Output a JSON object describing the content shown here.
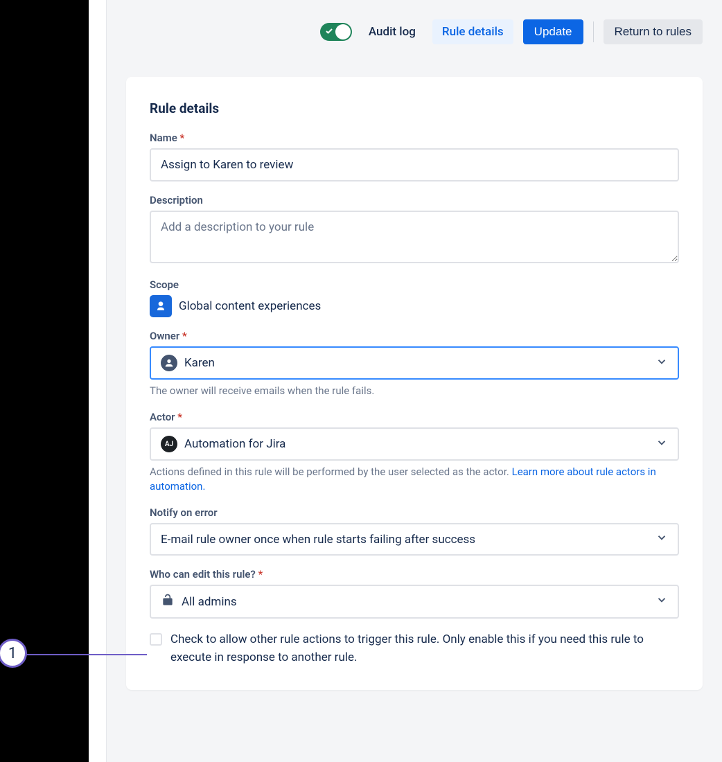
{
  "header": {
    "audit_log": "Audit log",
    "rule_details": "Rule details",
    "update": "Update",
    "return": "Return to rules"
  },
  "card": {
    "title": "Rule details",
    "name": {
      "label": "Name",
      "value": "Assign to Karen to review"
    },
    "description": {
      "label": "Description",
      "placeholder": "Add a description to your rule"
    },
    "scope": {
      "label": "Scope",
      "value": "Global content experiences"
    },
    "owner": {
      "label": "Owner",
      "value": "Karen",
      "helper": "The owner will receive emails when the rule fails."
    },
    "actor": {
      "label": "Actor",
      "value": "Automation for Jira",
      "avatar_text": "AJ",
      "helper_pre": "Actions defined in this rule will be performed by the user selected as the actor. ",
      "helper_link": "Learn more about rule actors in automation."
    },
    "notify": {
      "label": "Notify on error",
      "value": "E-mail rule owner once when rule starts failing after success"
    },
    "edit": {
      "label": "Who can edit this rule?",
      "value": "All admins"
    },
    "checkbox_label": "Check to allow other rule actions to trigger this rule. Only enable this if you need this rule to execute in response to another rule."
  },
  "annotation": {
    "number": "1"
  }
}
